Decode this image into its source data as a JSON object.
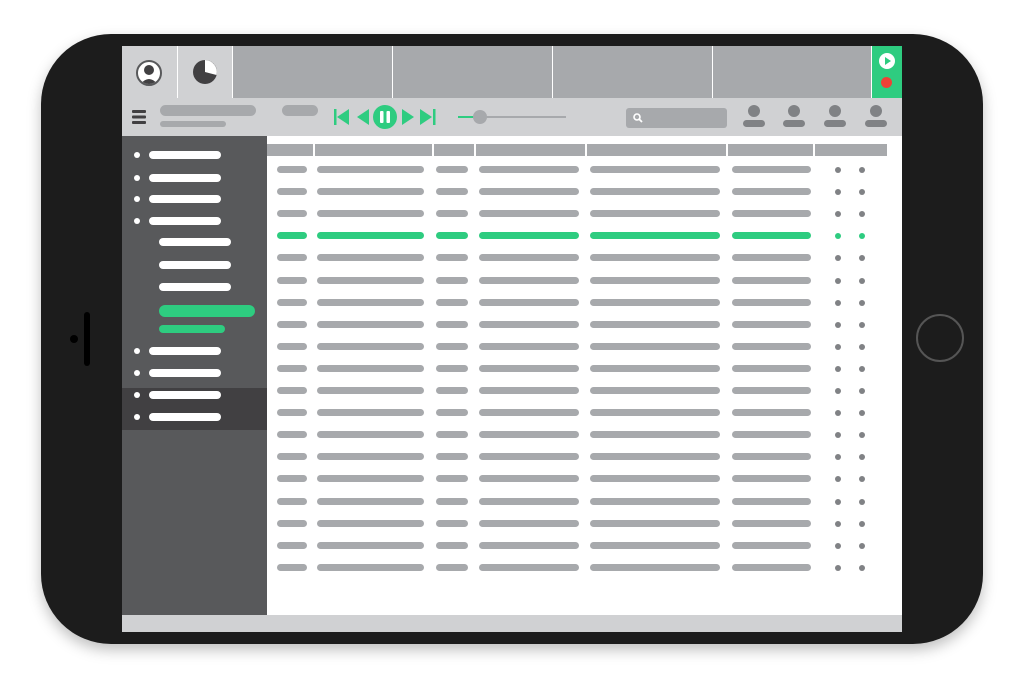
{
  "device": {
    "type": "tablet-landscape"
  },
  "colors": {
    "accent": "#2ecc80",
    "record": "#ef4136",
    "sidebar": "#58595b",
    "sidebar_active": "#414042",
    "placeholder_bar": "#a7a9ac",
    "toolbar": "#d0d1d3",
    "bezel": "#1c1c1c"
  },
  "topbar": {
    "tabs": [
      {
        "icon": "user-avatar-icon"
      },
      {
        "icon": "pie-chart-icon"
      },
      {
        "icon": ""
      },
      {
        "icon": ""
      },
      {
        "icon": ""
      },
      {
        "icon": ""
      }
    ],
    "record_panel": {
      "play_icon": "play-circle-icon",
      "record_icon": "record-dot-icon"
    }
  },
  "toolbar": {
    "menu_icon": "hamburger-menu-icon",
    "transport": [
      "skip-back-icon",
      "rewind-icon",
      "pause-icon",
      "play-icon",
      "skip-forward-icon"
    ],
    "volume_level": 0.2,
    "search_icon": "search-icon",
    "users": [
      "user-icon",
      "user-icon",
      "user-icon",
      "user-icon"
    ]
  },
  "sidebar": {
    "items": [
      {
        "level": 1,
        "active": false
      },
      {
        "level": 1,
        "active": false
      },
      {
        "level": 1,
        "active": false
      },
      {
        "level": 1,
        "active": false
      },
      {
        "level": 2,
        "active": false
      },
      {
        "level": 2,
        "active": false
      },
      {
        "level": 2,
        "active": false
      },
      {
        "level": 2,
        "active": true
      },
      {
        "level": 1,
        "active": false
      },
      {
        "level": 1,
        "active": false
      },
      {
        "level": 1,
        "active": false
      },
      {
        "level": 1,
        "active": false
      }
    ]
  },
  "table": {
    "columns": 7,
    "row_count": 19,
    "highlighted_row": 3
  }
}
